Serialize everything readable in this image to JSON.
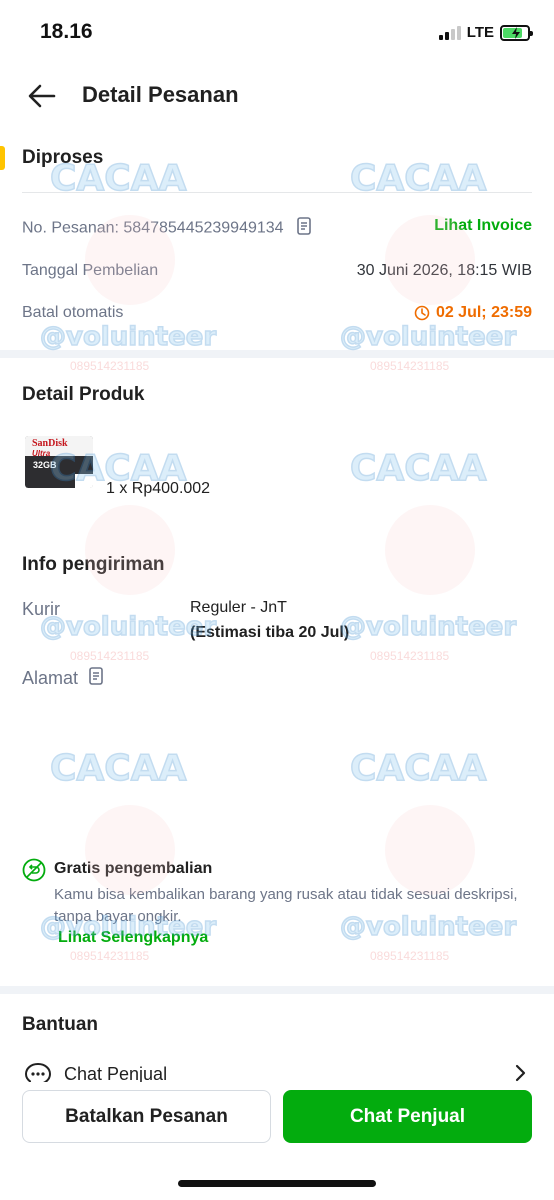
{
  "status_bar": {
    "time": "18.16",
    "network": "LTE",
    "battery_level": 0.8
  },
  "header": {
    "title": "Detail Pesanan",
    "back_icon": "arrow-left-icon"
  },
  "order": {
    "status": "Diproses",
    "order_number_label": "No. Pesanan: 584785445239949134",
    "invoice_link": "Lihat Invoice",
    "purchase_date_label": "Tanggal Pembelian",
    "purchase_date_value": "30 Juni 2026, 18:15 WIB",
    "auto_cancel_label": "Batal otomatis",
    "auto_cancel_value": "02 Jul; 23:59"
  },
  "product": {
    "section_title": "Detail Produk",
    "thumb_brand": "SanDisk",
    "thumb_line": "Ultra",
    "thumb_capacity": "32GB",
    "qty_price": "1 x Rp400.002"
  },
  "shipping": {
    "section_title": "Info pengiriman",
    "courier_label": "Kurir",
    "courier_value": "Reguler - JnT",
    "estimate": "(Estimasi tiba 20 Jul)",
    "address_label": "Alamat"
  },
  "returns": {
    "title": "Gratis pengembalian",
    "description": "Kamu bisa kembalikan barang yang rusak atau tidak sesuai deskripsi, tanpa bayar ongkir.",
    "link": "Lihat Selengkapnya"
  },
  "help": {
    "section_title": "Bantuan",
    "chat_label": "Chat Penjual"
  },
  "actions": {
    "cancel_label": "Batalkan Pesanan",
    "chat_label": "Chat Penjual"
  },
  "watermark": {
    "name": "CACAA",
    "handle": "@voluinteer",
    "phone": "089514231185"
  },
  "colors": {
    "primary_green": "#03ac0e",
    "status_accent": "#ffc400",
    "warning_orange": "#ef6c00"
  }
}
